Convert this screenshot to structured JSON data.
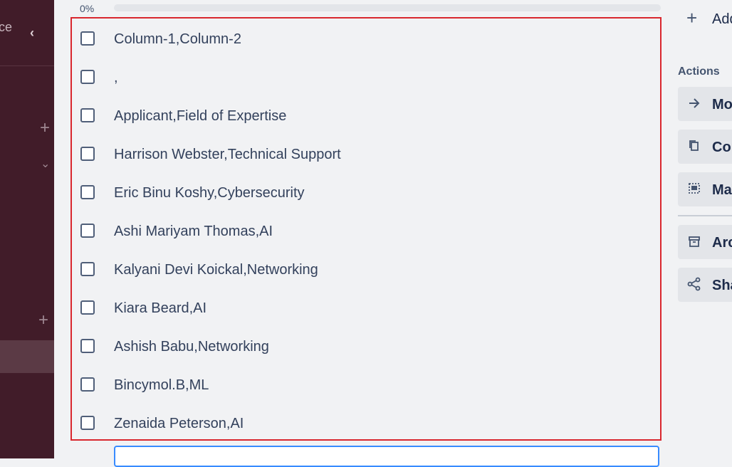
{
  "sidebar": {
    "fragment_text": "ce",
    "collapse_glyph": "‹",
    "plus_glyph": "+",
    "chevron_glyph": "⌄"
  },
  "progress": {
    "label": "0%",
    "value_percent": 0
  },
  "checklist": {
    "items": [
      {
        "text": "Column-1,Column-2",
        "checked": false
      },
      {
        "text": ",",
        "checked": false
      },
      {
        "text": "Applicant,Field of Expertise",
        "checked": false
      },
      {
        "text": "Harrison Webster,Technical Support",
        "checked": false
      },
      {
        "text": "Eric Binu Koshy,Cybersecurity",
        "checked": false
      },
      {
        "text": "Ashi Mariyam Thomas,AI",
        "checked": false
      },
      {
        "text": "Kalyani Devi Koickal,Networking",
        "checked": false
      },
      {
        "text": "Kiara Beard,AI",
        "checked": false
      },
      {
        "text": "Ashish Babu,Networking",
        "checked": false
      },
      {
        "text": "Bincymol.B,ML",
        "checked": false
      },
      {
        "text": "Zenaida Peterson,AI",
        "checked": false
      }
    ]
  },
  "right_panel": {
    "add_label": "Add",
    "actions_heading": "Actions",
    "actions": [
      {
        "label": "Move",
        "icon": "arrow-right-icon"
      },
      {
        "label": "Copy",
        "icon": "copy-icon"
      },
      {
        "label": "Make template",
        "icon": "template-icon"
      },
      {
        "label": "Archive",
        "icon": "archive-icon"
      },
      {
        "label": "Share",
        "icon": "share-icon"
      }
    ]
  },
  "colors": {
    "sidebar_bg": "#411c29",
    "highlight_border": "#d9272e",
    "input_border": "#388bff",
    "text": "#33415c"
  }
}
